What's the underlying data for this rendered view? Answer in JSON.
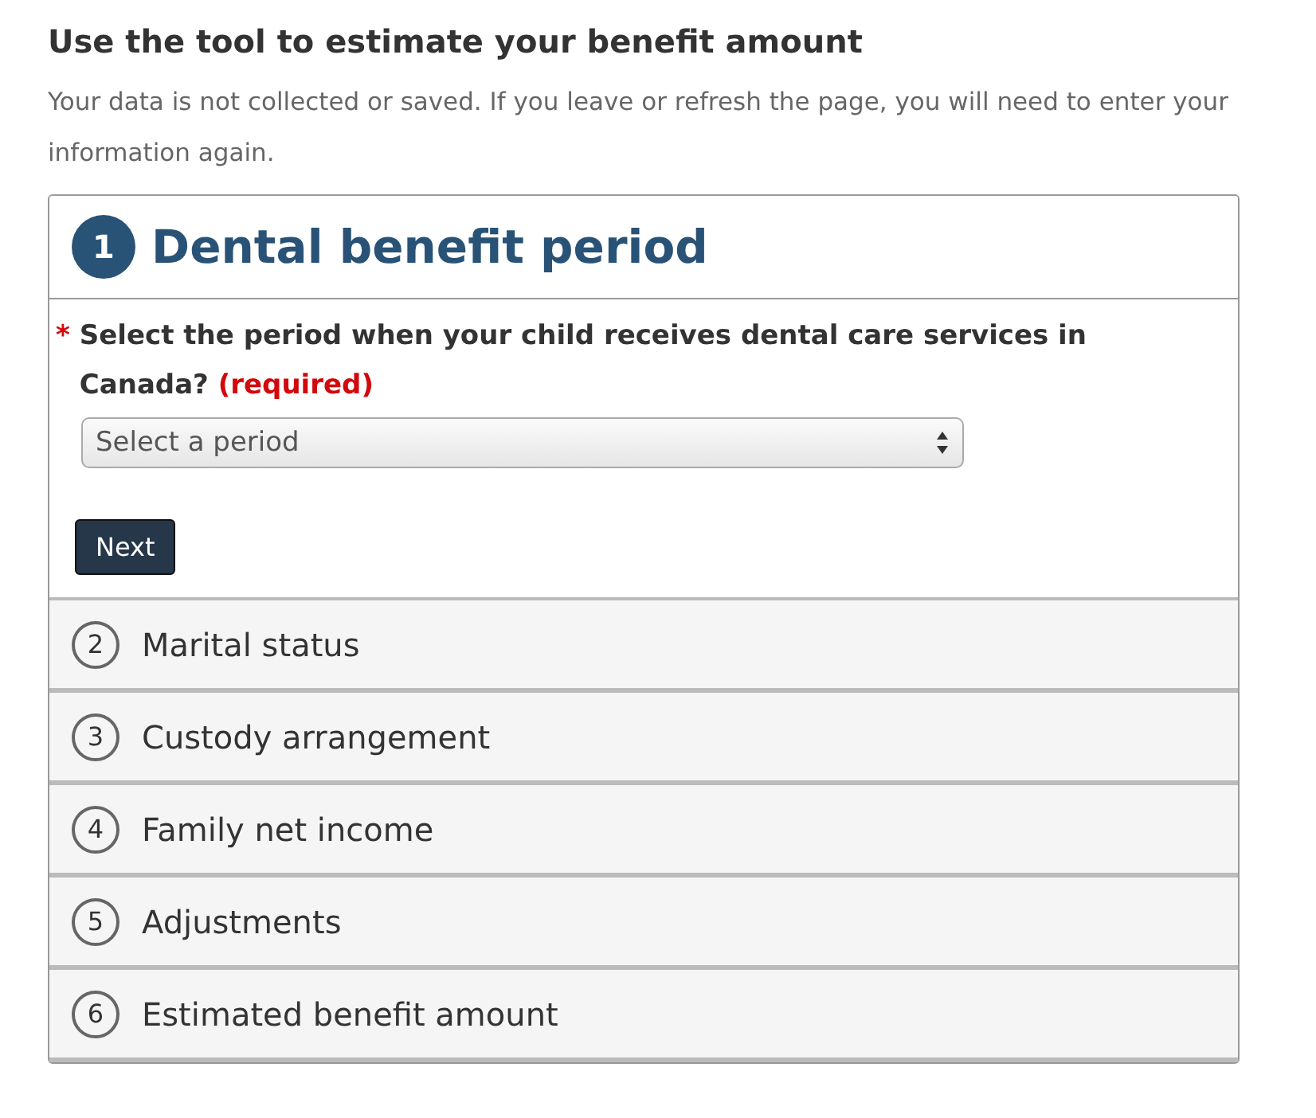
{
  "heading": "Use the tool to estimate your benefit amount",
  "notice": "Your data is not collected or saved. If you leave or refresh the page, you will need to enter your information again.",
  "steps": [
    {
      "number": "1",
      "title": "Dental benefit period",
      "expanded": true,
      "required_mark": "*",
      "question": "Select the period when your child receives dental care services in Canada?",
      "required_label": "(required)",
      "select": {
        "value": "Select a period"
      },
      "button": "Next"
    },
    {
      "number": "2",
      "title": "Marital status",
      "expanded": false
    },
    {
      "number": "3",
      "title": "Custody arrangement",
      "expanded": false
    },
    {
      "number": "4",
      "title": "Family net income",
      "expanded": false
    },
    {
      "number": "5",
      "title": "Adjustments",
      "expanded": false
    },
    {
      "number": "6",
      "title": "Estimated benefit amount",
      "expanded": false
    }
  ]
}
